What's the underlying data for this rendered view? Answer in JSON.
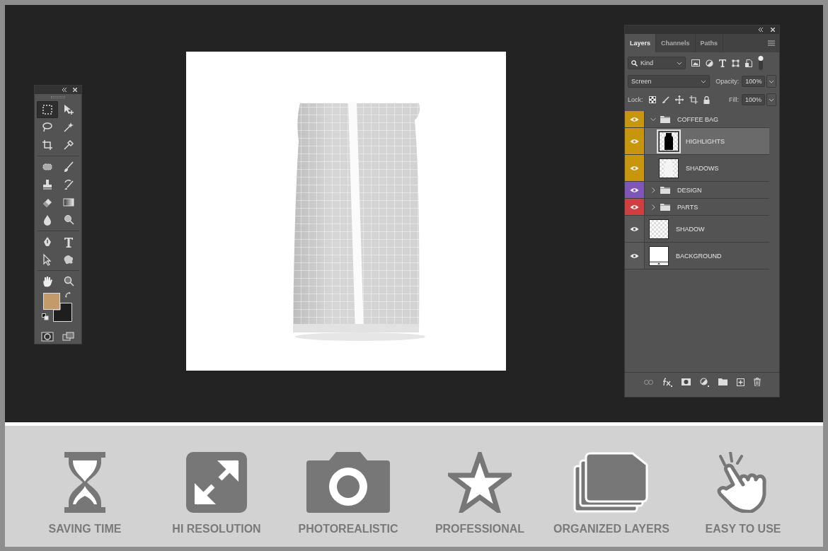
{
  "toolbar": {
    "tools": [
      {
        "selected": true
      },
      {
        "selected": false
      },
      {
        "selected": false
      },
      {
        "selected": false
      },
      {
        "selected": false
      },
      {
        "selected": false
      },
      {
        "selected": false
      },
      {
        "selected": false
      },
      {
        "selected": false
      },
      {
        "selected": false
      },
      {
        "selected": false
      },
      {
        "selected": false
      },
      {
        "selected": false
      },
      {
        "selected": false
      },
      {
        "selected": false
      },
      {
        "selected": false
      },
      {
        "selected": false
      },
      {
        "selected": false
      },
      {
        "selected": false
      },
      {
        "selected": false
      }
    ],
    "swatches": [
      {
        "color": "#c39b6b"
      },
      {
        "color": "#1e1e1e"
      }
    ]
  },
  "layers_panel": {
    "tabs": [
      {
        "label": "Layers",
        "selected": true
      },
      {
        "label": "Channels",
        "selected": false
      },
      {
        "label": "Paths",
        "selected": false
      }
    ],
    "filter": {
      "value": "Kind"
    },
    "blend_mode": {
      "value": "Screen"
    },
    "opacity": {
      "label": "Opacity:",
      "value": "100%"
    },
    "lock": {
      "label": "Lock:"
    },
    "fill": {
      "label": "Fill:",
      "value": "100%"
    },
    "layers": [
      {
        "name": "COFFEE BAG",
        "kind": "group",
        "expanded": true,
        "selected": false,
        "color": "#c8960c",
        "children": [
          {
            "name": "HIGHLIGHTS",
            "kind": "silhouette",
            "selected": true,
            "color": "#c8960c"
          },
          {
            "name": "SHADOWS",
            "kind": "light",
            "selected": false,
            "color": "#c8960c"
          }
        ]
      },
      {
        "name": "DESIGN",
        "kind": "group",
        "expanded": false,
        "selected": false,
        "color": "#7f56b8"
      },
      {
        "name": "PARTS",
        "kind": "group",
        "expanded": false,
        "selected": false,
        "color": "#cf3f3f"
      },
      {
        "name": "SHADOW",
        "kind": "transparent",
        "selected": false,
        "color": "#5a5a5a"
      },
      {
        "name": "BACKGROUND",
        "kind": "solid",
        "selected": false,
        "color": "#5a5a5a"
      }
    ]
  },
  "features": [
    {
      "label": "SAVING TIME"
    },
    {
      "label": "HI RESOLUTION"
    },
    {
      "label": "PHOTOREALISTIC"
    },
    {
      "label": "PROFESSIONAL"
    },
    {
      "label": "ORGANIZED LAYERS"
    },
    {
      "label": "EASY TO USE"
    }
  ]
}
